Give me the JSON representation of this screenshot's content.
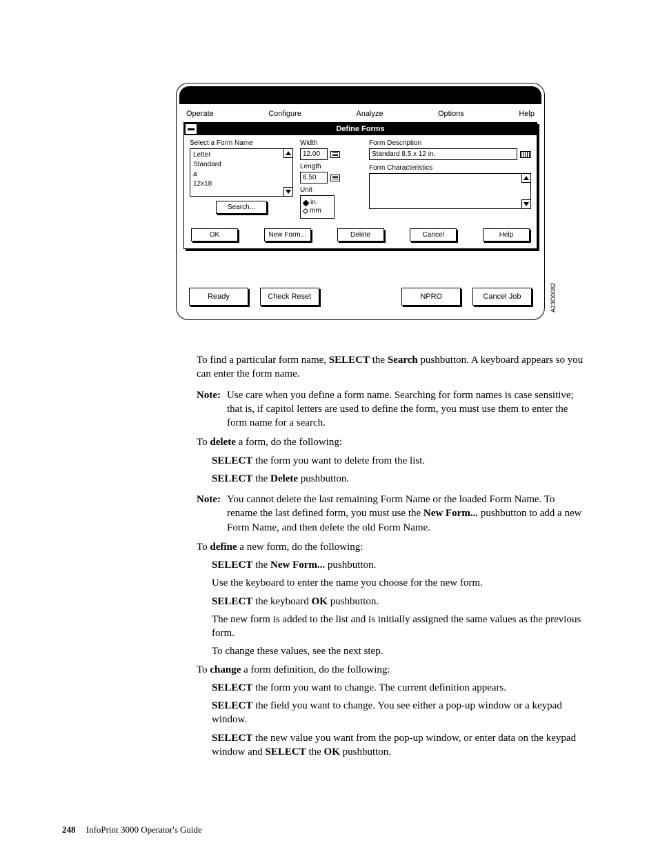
{
  "menubar": {
    "operate": "Operate",
    "configure": "Configure",
    "analyze": "Analyze",
    "options": "Options",
    "help": "Help"
  },
  "dialog": {
    "title": "Define Forms",
    "select_label": "Select a Form Name",
    "items": {
      "i0": "Letter",
      "i1": "Standard",
      "i2": "a",
      "i3": "12x18"
    },
    "search": "Search...",
    "width_label": "Width",
    "width_val": "12.00",
    "length_label": "Length",
    "length_val": "8.50",
    "unit_label": "Unit",
    "unit_in": "in.",
    "unit_mm": "mm",
    "desc_label": "Form Description",
    "desc_val": "Standard 8.5 x 12 in.",
    "char_label": "Form Characteristics",
    "buttons": {
      "ok": "OK",
      "newform": "New Form...",
      "delete": "Delete",
      "cancel": "Cancel",
      "help": "Help"
    }
  },
  "main_buttons": {
    "ready": "Ready",
    "check_reset": "Check Reset",
    "npro": "NPRO",
    "cancel_job": "Cancel Job"
  },
  "figure_id": "A23O0082",
  "text": {
    "p1a": "To find a particular form name, ",
    "p1b": "SELECT",
    "p1c": " the ",
    "p1d": "Search",
    "p1e": " pushbutton. A keyboard appears so you can enter the form name.",
    "note1_label": "Note:",
    "note1": "Use care when you define a form name. Searching for form names is case sensitive; that is, if capitol letters are used to define the form, you must use them to enter the form name for a search.",
    "p2a": "To ",
    "p2b": "delete",
    "p2c": " a form, do the following:",
    "d1a": "SELECT",
    "d1b": " the form you want to delete from the list.",
    "d2a": "SELECT",
    "d2b": " the ",
    "d2c": "Delete",
    "d2d": " pushbutton.",
    "note2_label": "Note:",
    "note2a": "You cannot delete the last remaining Form Name or the loaded Form Name. To rename the last defined form, you must use the ",
    "note2b": "New Form...",
    "note2c": " pushbutton to add a new Form Name, and then delete the old Form Name.",
    "p3a": "To ",
    "p3b": "define",
    "p3c": " a new form, do the following:",
    "f1a": "SELECT",
    "f1b": " the ",
    "f1c": "New Form...",
    "f1d": " pushbutton.",
    "f2": "Use the keyboard to enter the name you choose for the new form.",
    "f3a": "SELECT",
    "f3b": " the keyboard ",
    "f3c": "OK",
    "f3d": " pushbutton.",
    "f4": "The new form is added to the list and is initially assigned the same values as the previous form.",
    "f5": "To change these values, see the next step.",
    "p4a": "To ",
    "p4b": "change",
    "p4c": " a form definition, do the following:",
    "c1a": "SELECT",
    "c1b": " the form you want to change. The current definition appears.",
    "c2a": "SELECT",
    "c2b": " the field you want to change. You see either a pop-up window or a keypad window.",
    "c3a": "SELECT",
    "c3b": " the new value you want from the pop-up window, or enter data on the keypad window and ",
    "c3c": "SELECT",
    "c3d": " the ",
    "c3e": "OK",
    "c3f": " pushbutton."
  },
  "footer": {
    "page": "248",
    "title": "InfoPrint 3000 Operator's Guide"
  }
}
